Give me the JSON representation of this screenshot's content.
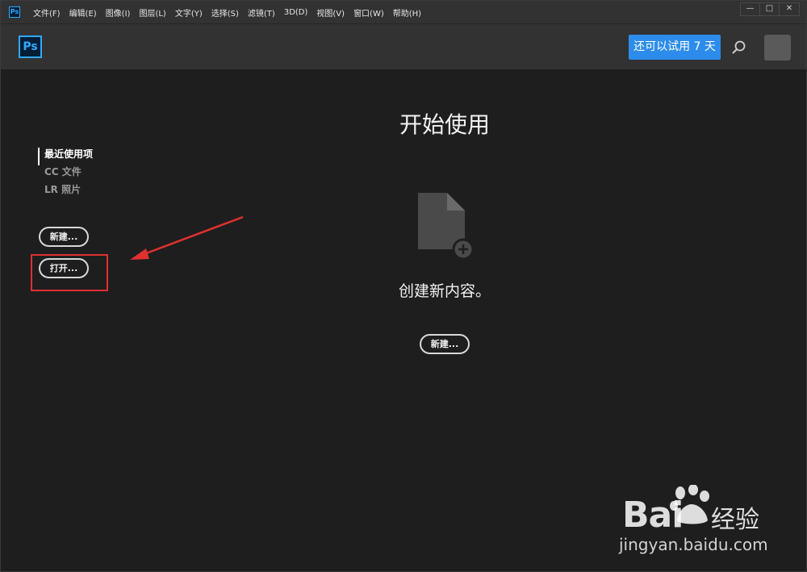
{
  "menubar": {
    "app_icon": "Ps",
    "items": [
      "文件(F)",
      "编辑(E)",
      "图像(I)",
      "图层(L)",
      "文字(Y)",
      "选择(S)",
      "滤镜(T)",
      "3D(D)",
      "视图(V)",
      "窗口(W)",
      "帮助(H)"
    ]
  },
  "window_controls": {
    "minimize": "—",
    "maximize": "□",
    "close": "✕"
  },
  "header": {
    "logo": "Ps",
    "trial_button": "还可以试用 7 天",
    "search_icon": "search-icon"
  },
  "sidebar": {
    "items": [
      {
        "label": "最近使用项",
        "active": true
      },
      {
        "label": "CC 文件",
        "active": false
      },
      {
        "label": "LR 照片",
        "active": false
      }
    ],
    "new_button": "新建...",
    "open_button": "打开..."
  },
  "main": {
    "title": "开始使用",
    "create_text": "创建新内容。",
    "new_button": "新建..."
  },
  "watermark": {
    "brand": "Bai",
    "brand_suffix": "经验",
    "url": "jingyan.baidu.com"
  },
  "colors": {
    "accent": "#31a8ff",
    "trial_button": "#2d8ceb",
    "annotation": "#e03030",
    "background": "#1e1e1e",
    "header": "#323232"
  }
}
